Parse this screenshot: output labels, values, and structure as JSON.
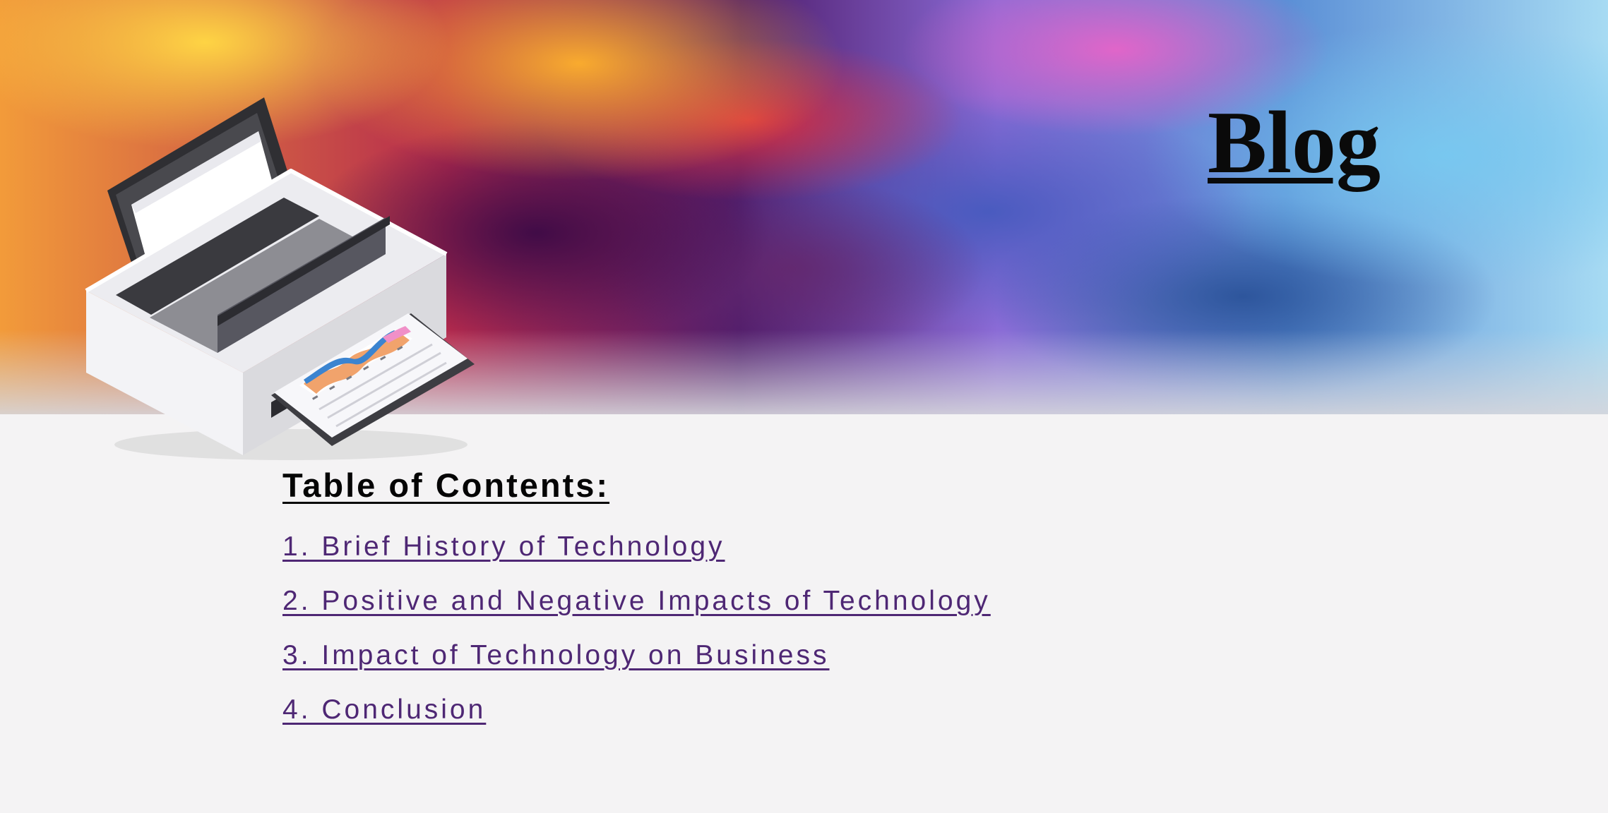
{
  "header": {
    "title": "Blog",
    "illustration": "printer-icon"
  },
  "toc": {
    "heading": "Table of Contents:",
    "items": [
      {
        "label": "1. Brief History of Technology"
      },
      {
        "label": "2. Positive and Negative Impacts of Technology"
      },
      {
        "label": "3. Impact of Technology on Business"
      },
      {
        "label": "4. Conclusion"
      }
    ]
  },
  "colors": {
    "background": "#f4f3f4",
    "title": "#0a0a0a",
    "link": "#4e2774"
  }
}
